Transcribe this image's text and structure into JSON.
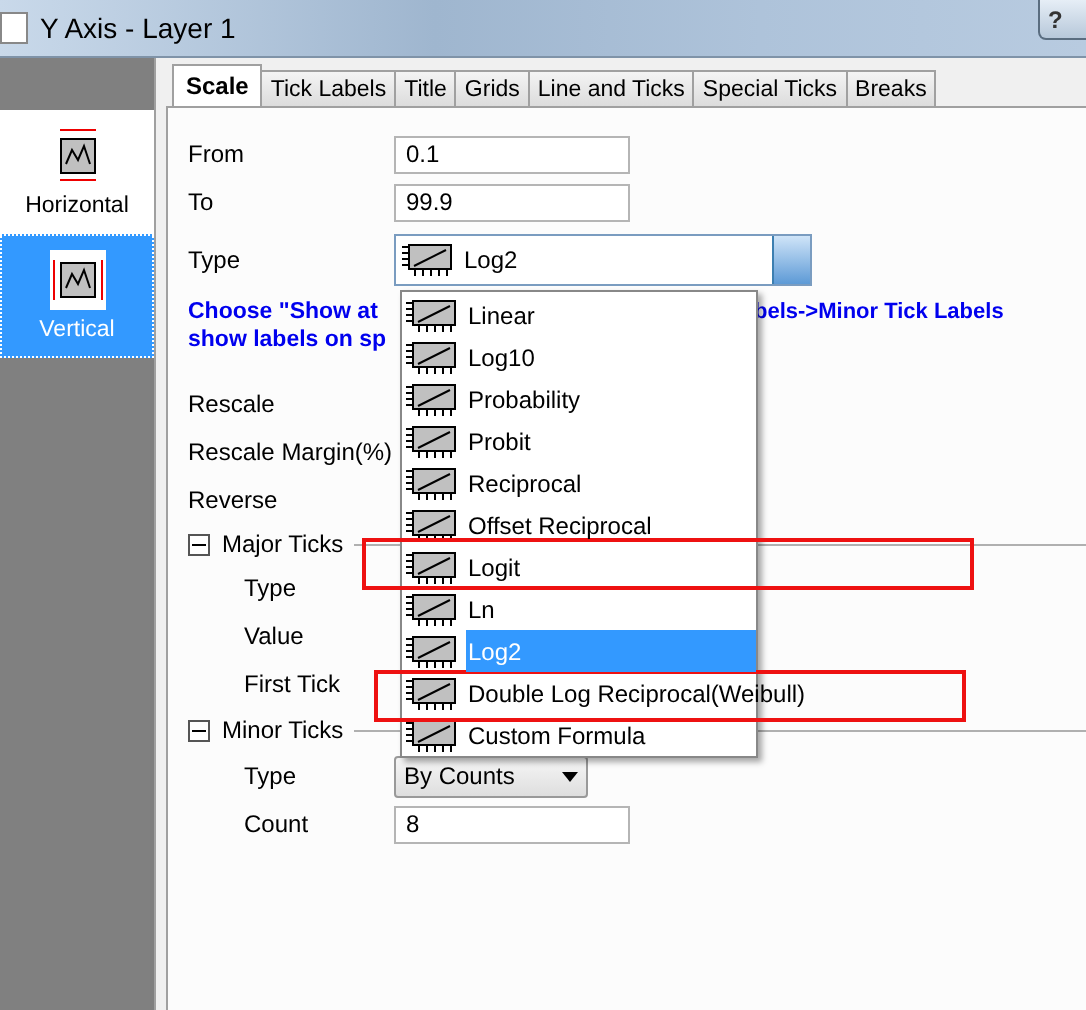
{
  "window": {
    "title": "Y Axis - Layer 1",
    "help": "?"
  },
  "sidebar": {
    "items": [
      {
        "label": "Horizontal",
        "selected": false
      },
      {
        "label": "Vertical",
        "selected": true
      }
    ]
  },
  "tabs": [
    {
      "label": "Scale",
      "selected": true
    },
    {
      "label": "Tick Labels",
      "selected": false
    },
    {
      "label": "Title",
      "selected": false
    },
    {
      "label": "Grids",
      "selected": false
    },
    {
      "label": "Line and Ticks",
      "selected": false
    },
    {
      "label": "Special Ticks",
      "selected": false
    },
    {
      "label": "Breaks",
      "selected": false
    }
  ],
  "from": {
    "label": "From",
    "value": "0.1"
  },
  "to": {
    "label": "To",
    "value": "99.9"
  },
  "type": {
    "label": "Type",
    "value": "Log2"
  },
  "note": {
    "left_lines": [
      "Choose \"Show at",
      "show labels on sp"
    ],
    "right": "bels->Minor Tick Labels"
  },
  "labels": [
    "Rescale",
    "Rescale Margin(%)",
    "Reverse"
  ],
  "major_ticks": {
    "label": "Major Ticks",
    "expanded": true,
    "rows": [
      "Type",
      "Value",
      "First Tick"
    ]
  },
  "minor_ticks": {
    "label": "Minor Ticks",
    "expanded": true,
    "type": {
      "label": "Type",
      "value": "By Counts"
    },
    "count": {
      "label": "Count",
      "value": "8"
    }
  },
  "type_menu": {
    "items": [
      {
        "label": "Linear",
        "selected": false,
        "highlighted": false
      },
      {
        "label": "Log10",
        "selected": false,
        "highlighted": false
      },
      {
        "label": "Probability",
        "selected": false,
        "highlighted": false
      },
      {
        "label": "Probit",
        "selected": false,
        "highlighted": false
      },
      {
        "label": "Reciprocal",
        "selected": false,
        "highlighted": false
      },
      {
        "label": "Offset Reciprocal",
        "selected": false,
        "highlighted": false
      },
      {
        "label": "Logit",
        "selected": false,
        "highlighted": true
      },
      {
        "label": "Ln",
        "selected": false,
        "highlighted": false
      },
      {
        "label": "Log2",
        "selected": true,
        "highlighted": false
      },
      {
        "label": "Double Log Reciprocal(Weibull)",
        "selected": false,
        "highlighted": true
      },
      {
        "label": "Custom Formula",
        "selected": false,
        "highlighted": false
      }
    ]
  }
}
